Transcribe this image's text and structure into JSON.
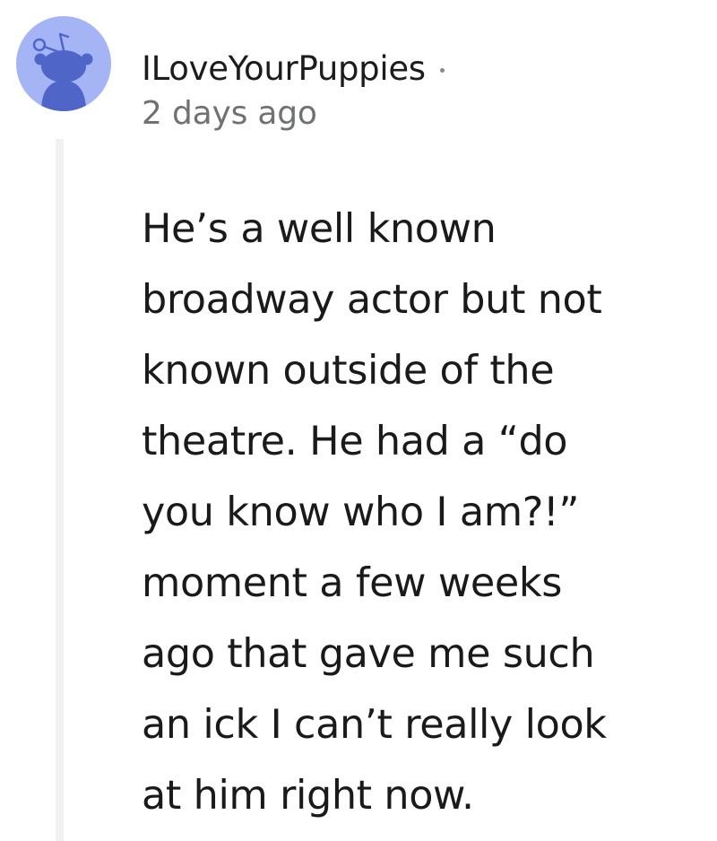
{
  "comment": {
    "username": "ILoveYourPuppies",
    "timestamp": "2 days ago",
    "body_lines": [
      "He’s a well known",
      "broadway actor but not",
      "known outside of the",
      "theatre. He had a “do",
      "you know who I am?!”",
      "moment a few weeks",
      "ago that gave me such",
      "an ick I can’t really look",
      "at him right now."
    ]
  },
  "avatar": {
    "icon": "snoo-avatar-icon",
    "background_color": "#a5b4f5",
    "figure_color": "#4f66c8"
  },
  "colors": {
    "text": "#1a1a1b",
    "meta": "#6f7173",
    "thread_line": "#f1f1f1"
  }
}
